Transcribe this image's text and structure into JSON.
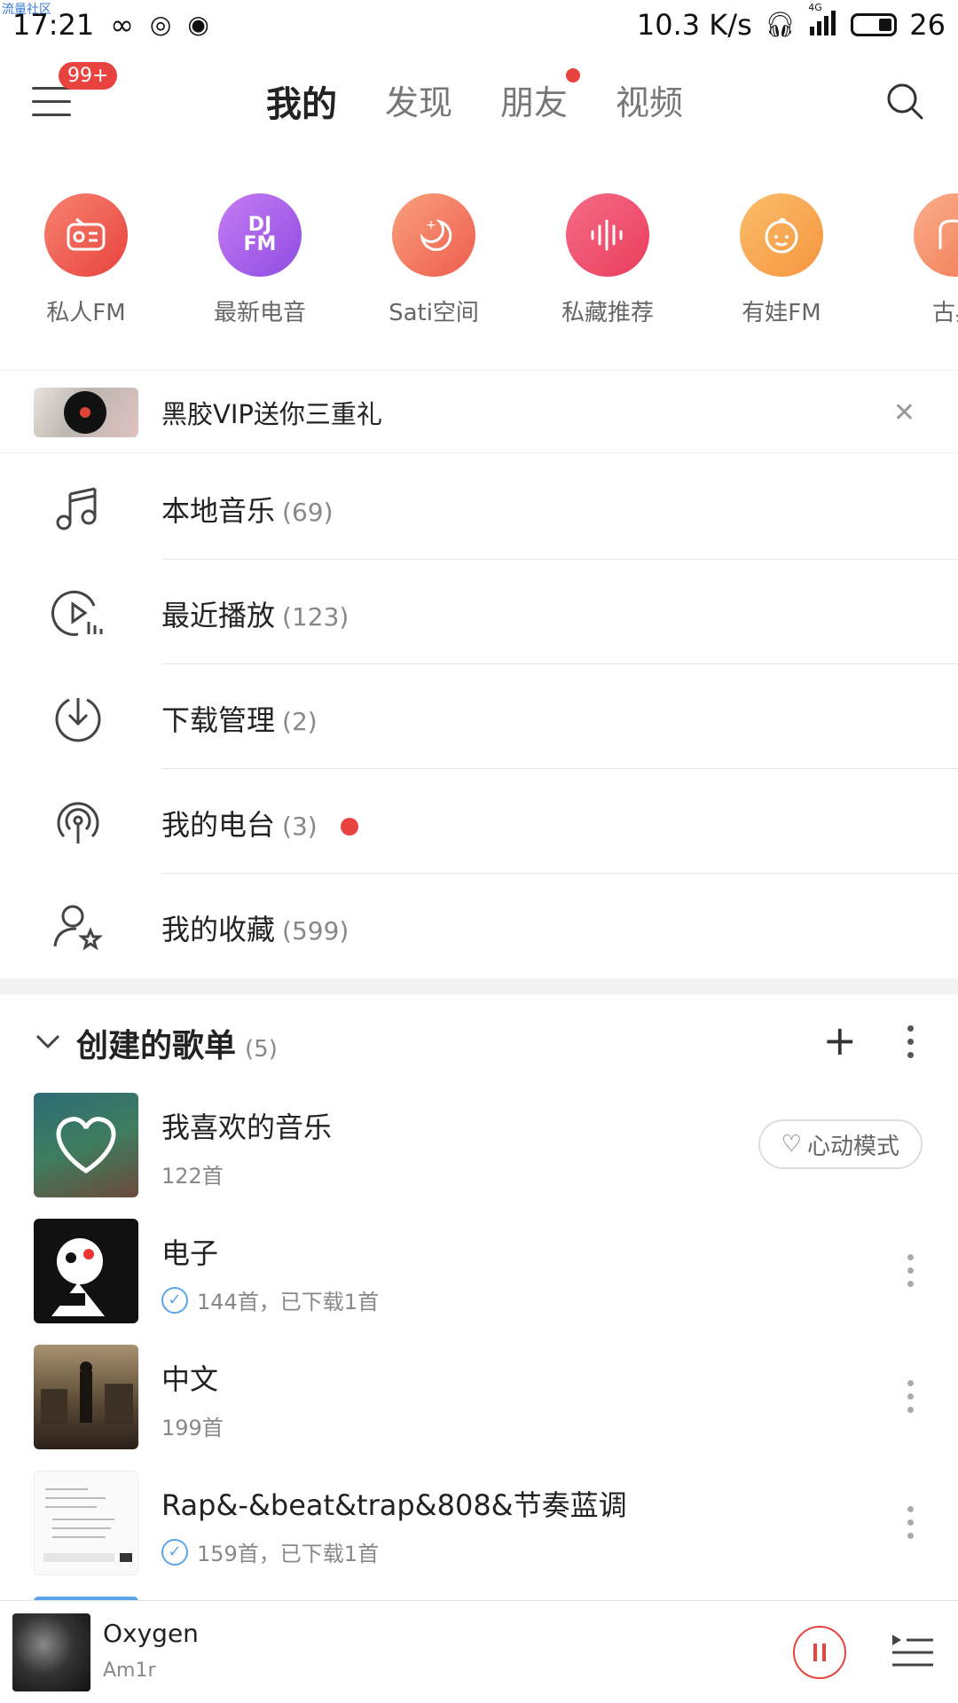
{
  "watermark": "流量社区",
  "status_bar": {
    "time": "17:21",
    "speed": "10.3 K/s",
    "battery": "26",
    "network": "4G"
  },
  "top_nav": {
    "badge": "99+",
    "tabs": [
      {
        "label": "我的",
        "active": true
      },
      {
        "label": "发现",
        "active": false
      },
      {
        "label": "朋友",
        "active": false,
        "dot": true
      },
      {
        "label": "视频",
        "active": false
      }
    ]
  },
  "quick_items": [
    {
      "label": "私人FM",
      "icon": "radio-icon"
    },
    {
      "label": "最新电音",
      "icon": "dj-fm-icon"
    },
    {
      "label": "Sati空间",
      "icon": "moon-icon"
    },
    {
      "label": "私藏推荐",
      "icon": "waveform-icon"
    },
    {
      "label": "有娃FM",
      "icon": "baby-icon"
    },
    {
      "label": "古典",
      "icon": "piano-icon"
    }
  ],
  "promo": {
    "text": "黑胶VIP送你三重礼"
  },
  "menu_list": [
    {
      "label": "本地音乐",
      "count": "(69)",
      "icon": "music-note-icon"
    },
    {
      "label": "最近播放",
      "count": "(123)",
      "icon": "recent-play-icon"
    },
    {
      "label": "下载管理",
      "count": "(2)",
      "icon": "download-icon"
    },
    {
      "label": "我的电台",
      "count": "(3)",
      "icon": "podcast-icon",
      "dot": true
    },
    {
      "label": "我的收藏",
      "count": "(599)",
      "icon": "favorite-user-icon"
    }
  ],
  "playlists": {
    "title": "创建的歌单",
    "count": "(5)",
    "items": [
      {
        "name": "我喜欢的音乐",
        "sub": "122首",
        "downloaded": false,
        "heart_mode": "心动模式"
      },
      {
        "name": "电子",
        "sub": "144首，已下载1首",
        "downloaded": true
      },
      {
        "name": "中文",
        "sub": "199首",
        "downloaded": false
      },
      {
        "name": "Rap&-&beat&trap&808&节奏蓝调",
        "sub": "159首，已下载1首",
        "downloaded": true
      }
    ]
  },
  "mini_player": {
    "title": "Oxygen",
    "artist": "Am1r"
  },
  "colors": {
    "accent": "#e8433e",
    "check": "#5aa6e8"
  }
}
